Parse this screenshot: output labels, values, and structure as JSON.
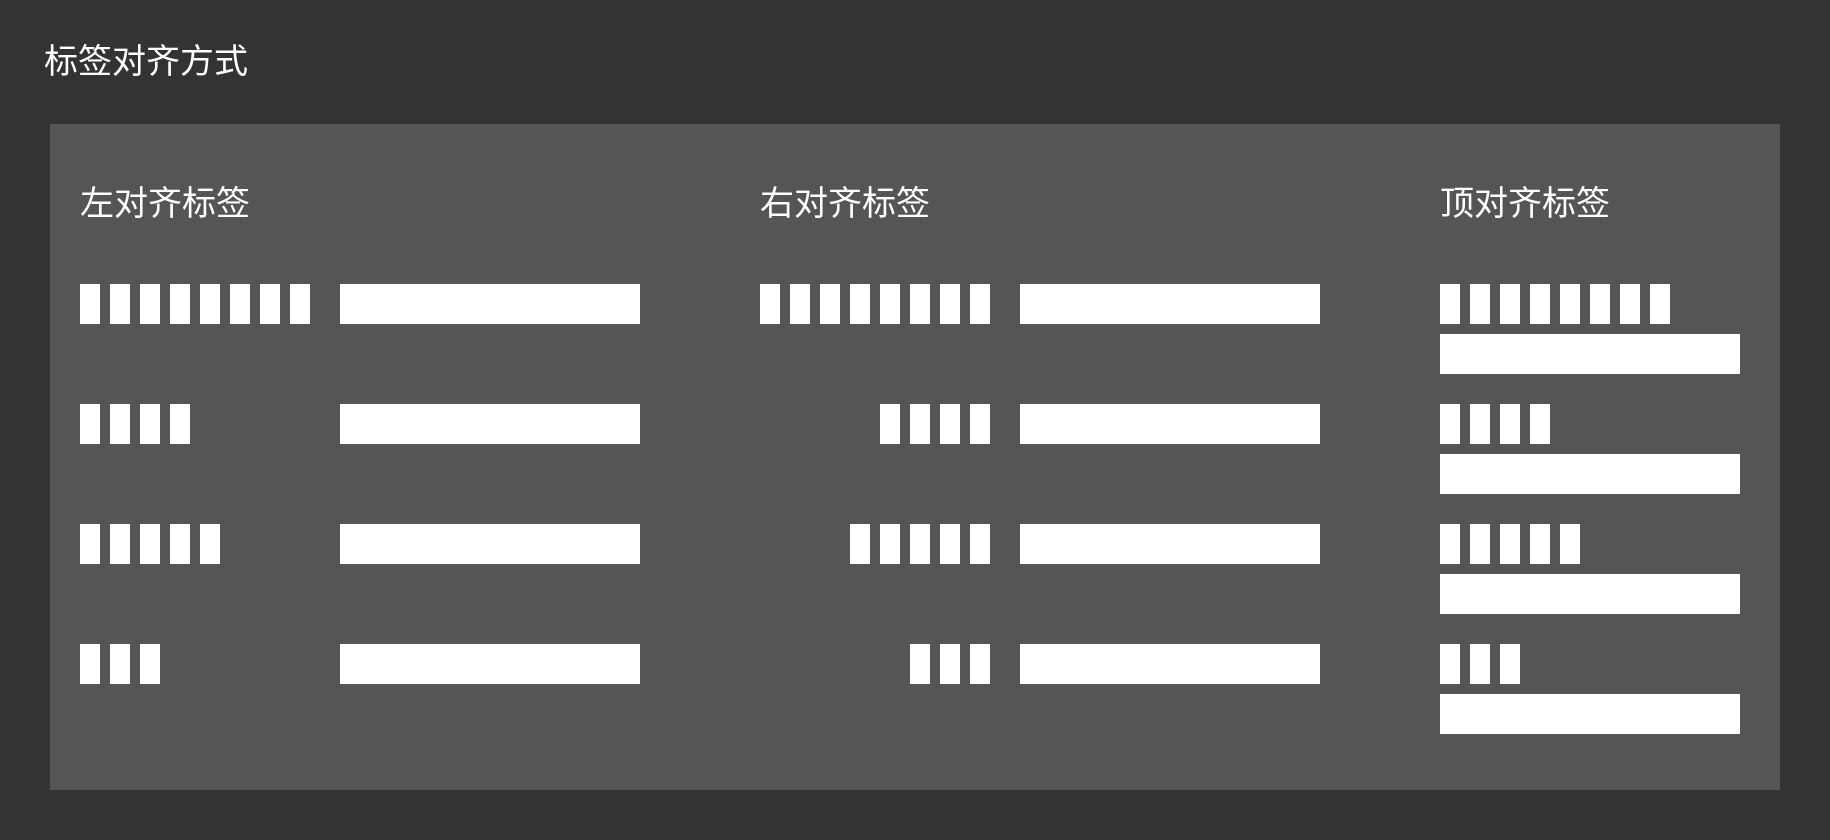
{
  "title": "标签对齐方式",
  "colors": {
    "background": "#333333",
    "panel": "#555555",
    "placeholder": "#ffffff"
  },
  "columns": [
    {
      "key": "left",
      "label": "左对齐标签"
    },
    {
      "key": "right",
      "label": "右对齐标签"
    },
    {
      "key": "top",
      "label": "顶对齐标签"
    }
  ],
  "label_segment_counts": [
    8,
    4,
    5,
    3
  ]
}
